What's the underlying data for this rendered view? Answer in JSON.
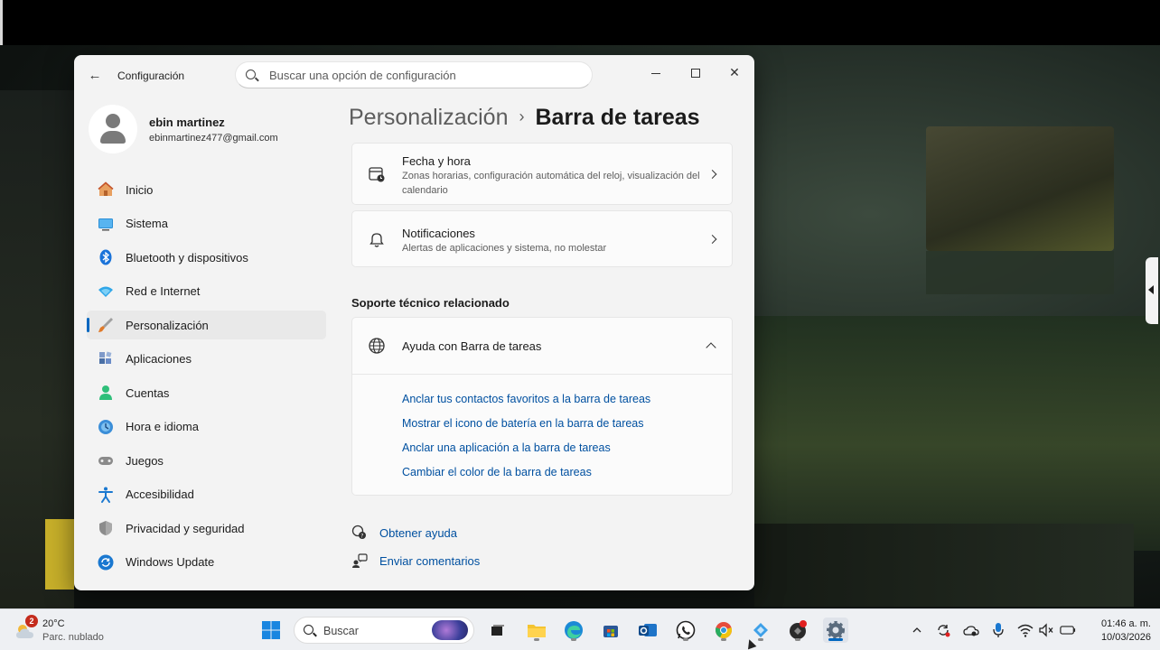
{
  "window": {
    "app_title": "Configuración",
    "search_placeholder": "Buscar una opción de configuración"
  },
  "profile": {
    "name": "ebin martinez",
    "email": "ebinmartinez477@gmail.com"
  },
  "sidebar": {
    "items": [
      {
        "label": "Inicio",
        "icon": "home-icon"
      },
      {
        "label": "Sistema",
        "icon": "system-icon"
      },
      {
        "label": "Bluetooth y dispositivos",
        "icon": "bluetooth-icon"
      },
      {
        "label": "Red e Internet",
        "icon": "network-icon"
      },
      {
        "label": "Personalización",
        "icon": "brush-icon",
        "active": true
      },
      {
        "label": "Aplicaciones",
        "icon": "apps-icon"
      },
      {
        "label": "Cuentas",
        "icon": "accounts-icon"
      },
      {
        "label": "Hora e idioma",
        "icon": "time-language-icon"
      },
      {
        "label": "Juegos",
        "icon": "gamepad-icon"
      },
      {
        "label": "Accesibilidad",
        "icon": "accessibility-icon"
      },
      {
        "label": "Privacidad y seguridad",
        "icon": "shield-icon"
      },
      {
        "label": "Windows Update",
        "icon": "update-icon"
      }
    ]
  },
  "breadcrumb": {
    "parent": "Personalización",
    "separator": "›",
    "current": "Barra de tareas"
  },
  "cards": {
    "datetime": {
      "title": "Fecha y hora",
      "description": "Zonas horarias, configuración automática del reloj, visualización del calendario"
    },
    "notifications": {
      "title": "Notificaciones",
      "description": "Alertas de aplicaciones y sistema, no molestar"
    }
  },
  "support": {
    "heading": "Soporte técnico relacionado",
    "help_title": "Ayuda con Barra de tareas",
    "links": [
      "Anclar tus contactos favoritos a la barra de tareas",
      "Mostrar el icono de batería en la barra de tareas",
      "Anclar una aplicación a la barra de tareas",
      "Cambiar el color de la barra de tareas"
    ]
  },
  "footer": {
    "get_help": "Obtener ayuda",
    "feedback": "Enviar comentarios"
  },
  "taskbar": {
    "weather_badge": "2",
    "temperature": "20°C",
    "condition": "Parc. nublado",
    "search_label": "Buscar",
    "time": "01:46 a. m.",
    "date": "10/03/2026"
  },
  "colors": {
    "accent": "#0067c0",
    "link": "#0050a0",
    "window_bg": "#f3f3f3",
    "card_bg": "#fbfbfb"
  }
}
